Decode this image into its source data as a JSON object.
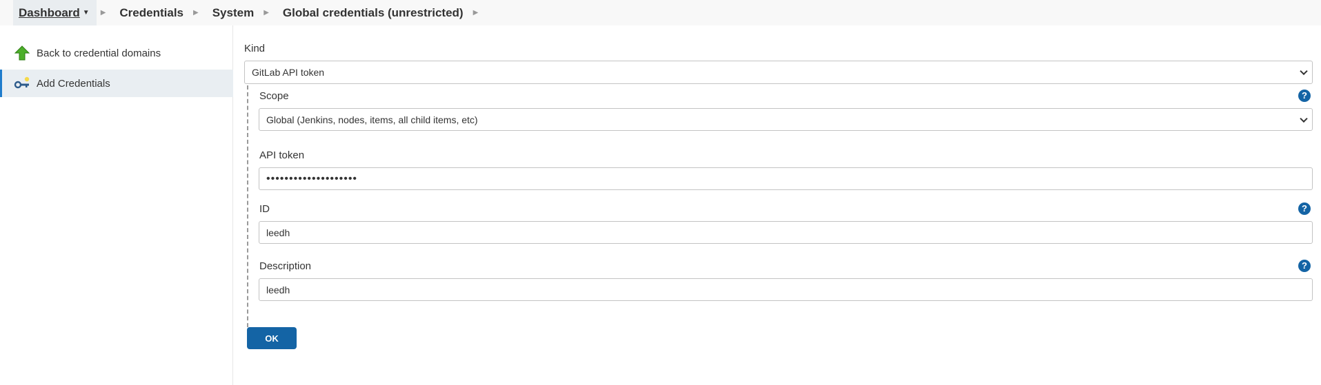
{
  "breadcrumb": {
    "items": [
      {
        "label": "Dashboard"
      },
      {
        "label": "Credentials"
      },
      {
        "label": "System"
      },
      {
        "label": "Global credentials (unrestricted)"
      }
    ]
  },
  "sidebar": {
    "back_label": "Back to credential domains",
    "add_label": "Add Credentials"
  },
  "form": {
    "kind_label": "Kind",
    "kind_value": "GitLab API token",
    "scope_label": "Scope",
    "scope_value": "Global (Jenkins, nodes, items, all child items, etc)",
    "token_label": "API token",
    "token_value": "••••••••••••••••••••",
    "id_label": "ID",
    "id_value": "leedh",
    "description_label": "Description",
    "description_value": "leedh",
    "help_glyph": "?",
    "ok_label": "OK"
  },
  "colors": {
    "accent": "#1464a5",
    "active_bar": "#1f7ccc",
    "active_bg": "#e9eef2"
  }
}
